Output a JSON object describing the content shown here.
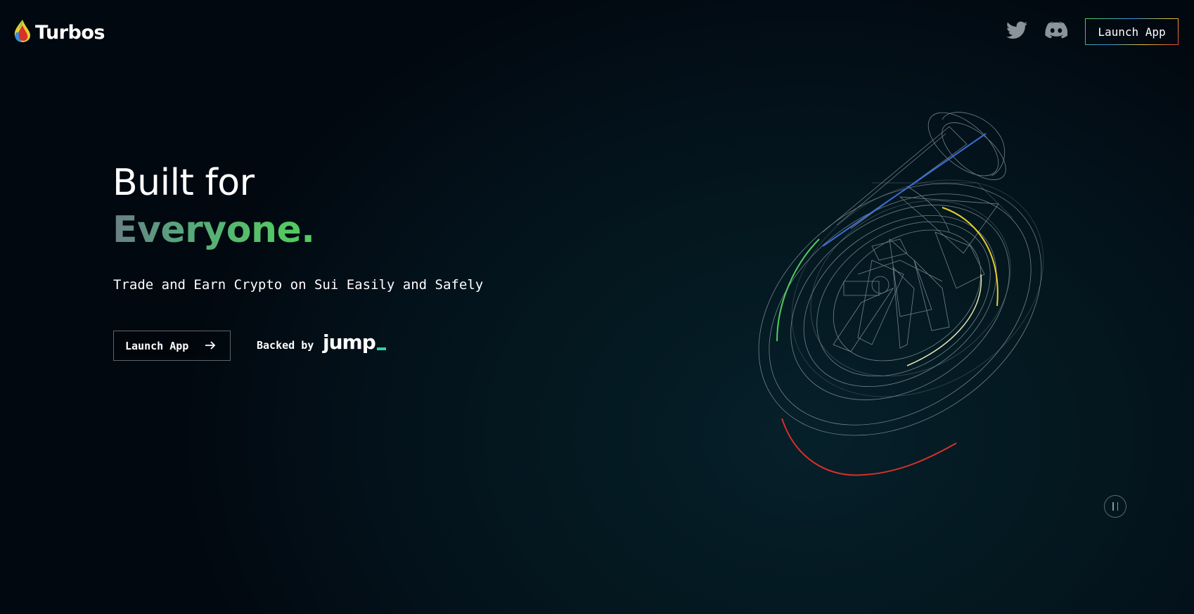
{
  "header": {
    "brand_name": "Turbos",
    "launch_label": "Launch App",
    "social": [
      {
        "icon": "twitter-icon"
      },
      {
        "icon": "discord-icon"
      }
    ]
  },
  "hero": {
    "title_line1": "Built for",
    "title_line2": "Everyone.",
    "subtitle": "Trade and Earn Crypto on Sui Easily and Safely",
    "cta_label": "Launch App",
    "backed_label": "Backed by",
    "backer_name": "jump"
  },
  "colors": {
    "accent_green": "#4fcf5a",
    "accent_blue": "#3a6fd8",
    "accent_yellow": "#e5cf2c",
    "accent_red": "#d8302a",
    "jump_teal": "#2ed3a6"
  },
  "illustration": {
    "icon": "turbo-wireframe-icon"
  },
  "controls": {
    "pause_icon": "pause-icon"
  }
}
